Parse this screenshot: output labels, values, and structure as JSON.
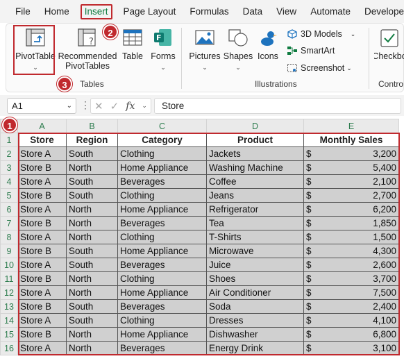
{
  "menu": {
    "tabs": [
      "File",
      "Home",
      "Insert",
      "Page Layout",
      "Formulas",
      "Data",
      "View",
      "Automate",
      "Developer"
    ],
    "active": "Insert"
  },
  "ribbon": {
    "pivot_table": "PivotTable",
    "recommended_1": "Recommended",
    "recommended_2": "PivotTables",
    "table": "Table",
    "forms": "Forms",
    "tables_group": "Tables",
    "pictures": "Pictures",
    "shapes": "Shapes",
    "icons": "Icons",
    "models_3d": "3D Models",
    "smartart": "SmartArt",
    "screenshot": "Screenshot",
    "illustrations_group": "Illustrations",
    "checkbox": "Checkbo",
    "controls_group": "Contro"
  },
  "badges": {
    "one": "1",
    "two": "2",
    "three": "3"
  },
  "formula_bar": {
    "name_box": "A1",
    "formula": "Store",
    "fx": "fx"
  },
  "columns": [
    "A",
    "B",
    "C",
    "D",
    "E"
  ],
  "headers": [
    "Store",
    "Region",
    "Category",
    "Product",
    "Monthly Sales"
  ],
  "currency": "$",
  "rows": [
    [
      "Store A",
      "South",
      "Clothing",
      "Jackets",
      "3,200"
    ],
    [
      "Store B",
      "North",
      "Home Appliance",
      "Washing Machine",
      "5,400"
    ],
    [
      "Store A",
      "South",
      "Beverages",
      "Coffee",
      "2,100"
    ],
    [
      "Store B",
      "South",
      "Clothing",
      "Jeans",
      "2,700"
    ],
    [
      "Store A",
      "North",
      "Home Appliance",
      "Refrigerator",
      "6,200"
    ],
    [
      "Store B",
      "North",
      "Beverages",
      "Tea",
      "1,850"
    ],
    [
      "Store A",
      "North",
      "Clothing",
      "T-Shirts",
      "1,500"
    ],
    [
      "Store B",
      "South",
      "Home Appliance",
      "Microwave",
      "4,300"
    ],
    [
      "Store A",
      "South",
      "Beverages",
      "Juice",
      "2,600"
    ],
    [
      "Store B",
      "North",
      "Clothing",
      "Shoes",
      "3,700"
    ],
    [
      "Store A",
      "North",
      "Home Appliance",
      "Air Conditioner",
      "7,500"
    ],
    [
      "Store B",
      "South",
      "Beverages",
      "Soda",
      "2,400"
    ],
    [
      "Store A",
      "South",
      "Clothing",
      "Dresses",
      "4,100"
    ],
    [
      "Store B",
      "North",
      "Home Appliance",
      "Dishwasher",
      "6,800"
    ],
    [
      "Store A",
      "North",
      "Beverages",
      "Energy Drink",
      "3,100"
    ]
  ],
  "row_numbers": [
    "1",
    "2",
    "3",
    "4",
    "5",
    "6",
    "7",
    "8",
    "9",
    "10",
    "11",
    "12",
    "13",
    "14",
    "15",
    "16"
  ],
  "colors": {
    "accent_green": "#107c41",
    "highlight_red": "#c0292e",
    "selection_fill": "#d0d0d0"
  }
}
